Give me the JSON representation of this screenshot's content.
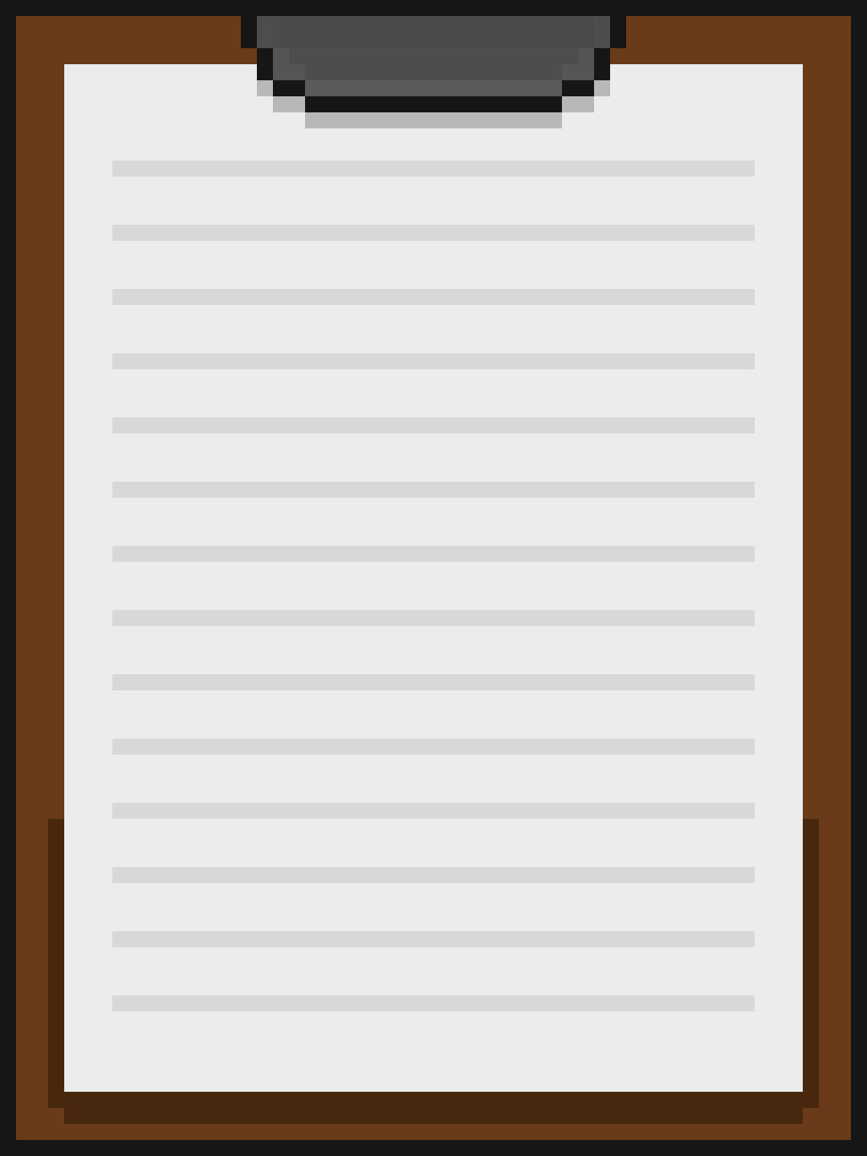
{
  "clipboard": {
    "line_count": 14,
    "colors": {
      "background": "#161616",
      "board": "#6a3b19",
      "board_shadow": "#48270f",
      "paper": "#ececec",
      "rule_line": "#d8d8d8",
      "clip_dark": "#161616",
      "clip_body": "#4d4d4d",
      "clip_shade": "#5a5a5a",
      "clip_shadow": "#b8b8b8"
    },
    "icon": "clipboard-icon"
  }
}
